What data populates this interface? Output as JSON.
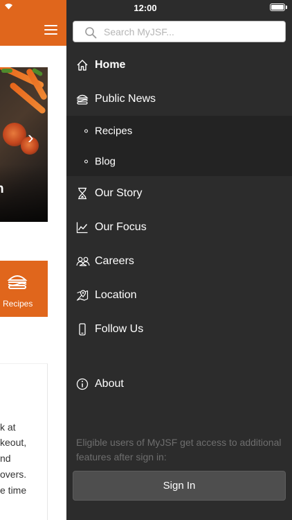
{
  "status_bar": {
    "time": "12:00"
  },
  "search": {
    "placeholder": "Search MyJSF..."
  },
  "nav": {
    "home": "Home",
    "public_news": "Public News",
    "sub_items": [
      "Recipes",
      "Blog"
    ],
    "our_story": "Our Story",
    "our_focus": "Our Focus",
    "careers": "Careers",
    "location": "Location",
    "follow_us": "Follow Us",
    "about": "About"
  },
  "sign_in": {
    "note": "Eligible users of MyJSF get access to additional features after sign in:",
    "button_label": "Sign In"
  },
  "background_app": {
    "hero_title": "h",
    "tile_label": "Recipes",
    "card_lines": [
      "k at",
      "keout,",
      "nd",
      "overs.",
      "e time"
    ]
  },
  "colors": {
    "accent": "#e0661c",
    "drawer_bg": "#2c2c2c",
    "subnav_bg": "#232323",
    "signin_button_bg": "#4e4e4e"
  },
  "icons": {
    "home": "home-icon",
    "public_news": "burger-icon",
    "our_story": "hourglass-icon",
    "our_focus": "line-chart-icon",
    "careers": "people-icon",
    "location": "map-pin-icon",
    "follow_us": "mobile-phone-icon",
    "about": "info-icon",
    "search": "search-icon"
  }
}
